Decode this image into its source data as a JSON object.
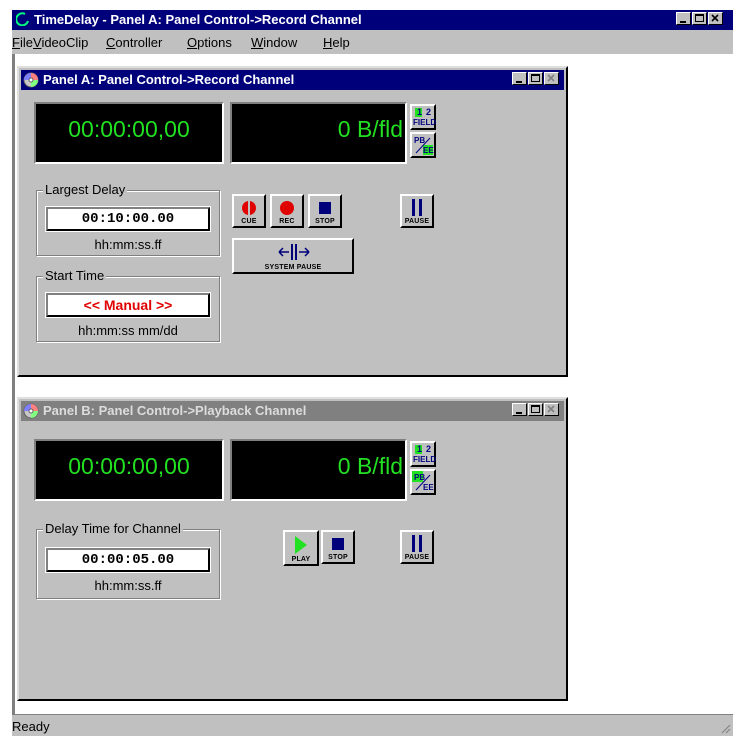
{
  "app": {
    "title": "TimeDelay - Panel A: Panel Control->Record Channel",
    "menu": [
      {
        "mnemonic": "F",
        "rest": "ile"
      },
      {
        "mnemonic": "V",
        "rest": "ideoClip"
      },
      {
        "mnemonic": "C",
        "rest": "ontroller"
      },
      {
        "mnemonic": "O",
        "rest": "ptions"
      },
      {
        "mnemonic": "W",
        "rest": "indow"
      },
      {
        "mnemonic": "H",
        "rest": "elp"
      }
    ],
    "status": "Ready"
  },
  "panel_a": {
    "title": "Panel A: Panel Control->Record Channel",
    "timecode": "00:00:00,00",
    "rate": "0 B/fld",
    "largest_delay": {
      "label": "Largest Delay",
      "value": "00:10:00.00",
      "format": "hh:mm:ss.ff"
    },
    "start_time": {
      "label": "Start Time",
      "value": "<< Manual >>",
      "format": "hh:mm:ss mm/dd"
    },
    "buttons": {
      "cue": "CUE",
      "rec": "REC",
      "stop": "STOP",
      "pause": "PAUSE",
      "system_pause": "SYSTEM PAUSE",
      "field": "FIELD",
      "field_nums": [
        "1",
        "2"
      ],
      "pb": "PB",
      "ee": "EE"
    }
  },
  "panel_b": {
    "title": "Panel B: Panel Control->Playback Channel",
    "timecode": "00:00:00,00",
    "rate": "0 B/fld",
    "delay_time": {
      "label": "Delay Time for Channel",
      "value": "00:00:05.00",
      "format": "hh:mm:ss.ff"
    },
    "buttons": {
      "play": "PLAY",
      "stop": "STOP",
      "pause": "PAUSE",
      "field": "FIELD",
      "field_nums": [
        "1",
        "2"
      ],
      "pb": "PB",
      "ee": "EE"
    }
  },
  "colors": {
    "title_active": "#00007b",
    "title_inactive": "#808080",
    "display_text": "#22e022",
    "manual_text": "#e00000",
    "face": "#c0c0c0"
  }
}
